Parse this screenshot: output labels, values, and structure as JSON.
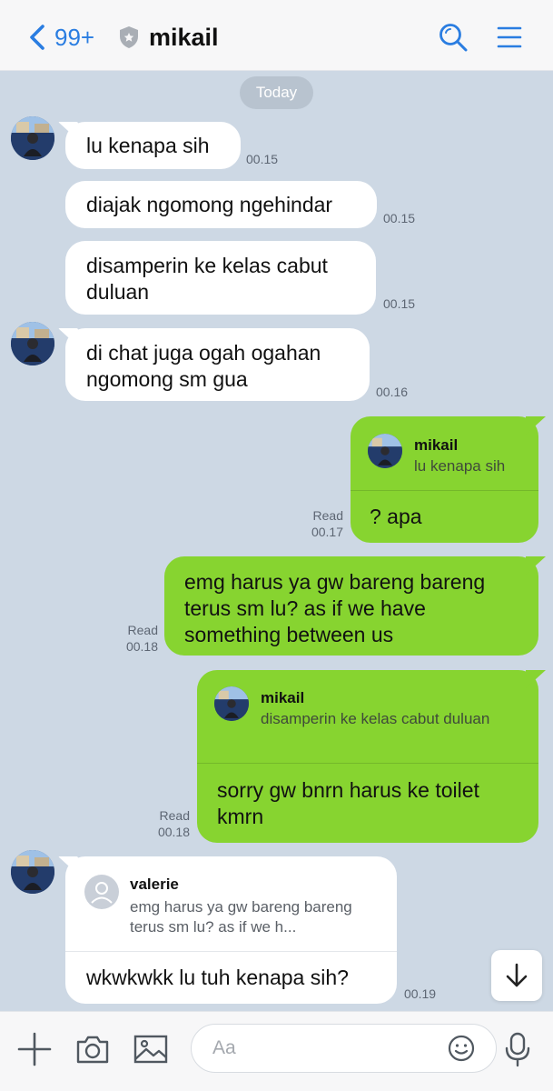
{
  "header": {
    "unread_count": "99+",
    "chat_title": "mikail"
  },
  "day_label": "Today",
  "messages": [
    {
      "side": "in",
      "text": "lu kenapa sih",
      "time": "00.15"
    },
    {
      "side": "in",
      "text": "diajak ngomong ngehindar",
      "time": "00.15"
    },
    {
      "side": "in",
      "text": "disamperin ke kelas cabut duluan",
      "time": "00.15"
    },
    {
      "side": "in",
      "text": "di chat juga ogah ogahan ngomong sm gua",
      "time": "00.16"
    },
    {
      "side": "out",
      "reply_name": "mikail",
      "reply_text": "lu kenapa sih",
      "text": "? apa",
      "status": "Read",
      "time": "00.17"
    },
    {
      "side": "out",
      "text": "emg harus ya gw bareng bareng terus sm lu? as if we have something between us",
      "status": "Read",
      "time": "00.18"
    },
    {
      "side": "out",
      "reply_name": "mikail",
      "reply_text": "disamperin ke kelas cabut duluan",
      "text": "sorry gw bnrn harus ke toilet kmrn",
      "status": "Read",
      "time": "00.18"
    },
    {
      "side": "in",
      "reply_name": "valerie",
      "reply_text": "emg harus ya gw bareng bareng terus sm lu? as if we h...",
      "text": "wkwkwkk lu tuh kenapa sih?",
      "time": "00.19"
    }
  ],
  "input": {
    "placeholder": "Aa"
  },
  "colors": {
    "accent": "#2a7de1",
    "chat_background": "#cdd8e4",
    "outgoing_bubble": "#87d430",
    "incoming_bubble": "#ffffff"
  },
  "icons": [
    "chevron-left-icon",
    "shield-icon",
    "search-icon",
    "menu-icon",
    "plus-icon",
    "camera-icon",
    "image-icon",
    "emoji-icon",
    "microphone-icon",
    "arrow-down-icon"
  ]
}
